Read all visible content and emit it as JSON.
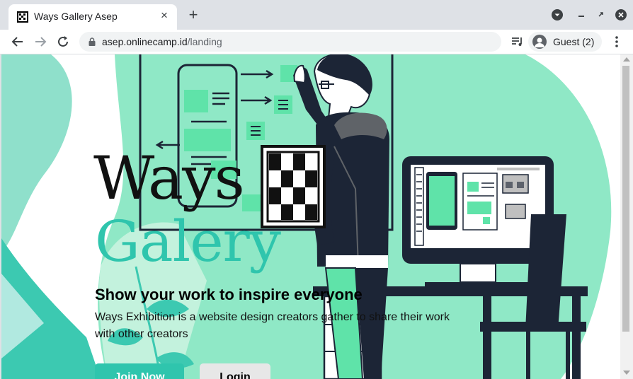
{
  "tab": {
    "title": "Ways Gallery Asep",
    "close_icon": "×"
  },
  "new_tab_icon": "+",
  "address": {
    "host": "asep.onlinecamp.id",
    "path": "/landing"
  },
  "profile": {
    "label": "Guest (2)"
  },
  "hero": {
    "title_line1": "Ways",
    "title_line2": "Galery",
    "subtitle": "Show your work to inspire everyone",
    "description": "Ways Exhibition is a website design creators gather to share their work with other creators",
    "join_button": "Join Now",
    "login_button": "Login"
  },
  "colors": {
    "accent": "#2fc5ad",
    "illustration_green": "#5fe3a9",
    "illustration_dark": "#1c2536",
    "tabbar": "#dee1e6"
  },
  "icons": [
    "favicon-icon",
    "close-icon",
    "plus-icon",
    "tab-search-icon",
    "minimize-icon",
    "restore-icon",
    "window-close-icon",
    "back-icon",
    "forward-icon",
    "reload-icon",
    "lock-icon",
    "reading-list-icon",
    "guest-avatar-icon",
    "kebab-menu-icon"
  ]
}
